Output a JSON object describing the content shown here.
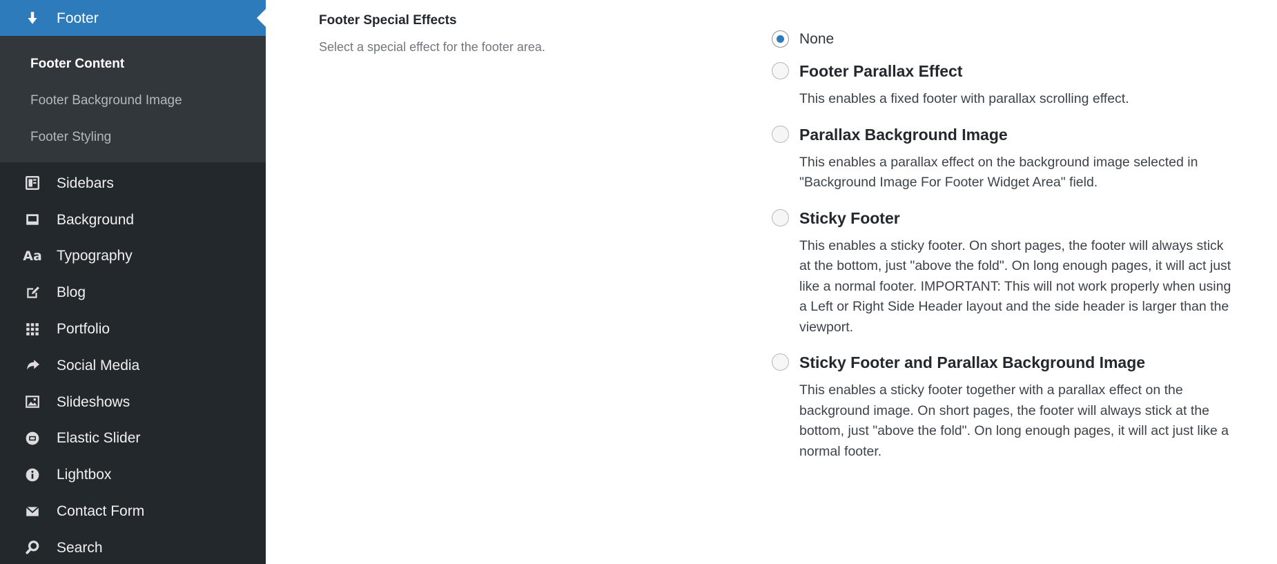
{
  "sidebar": {
    "active": {
      "label": "Footer",
      "icon": "arrow-down-icon"
    },
    "submenu": [
      {
        "label": "Footer Content",
        "current": true
      },
      {
        "label": "Footer Background Image",
        "current": false
      },
      {
        "label": "Footer Styling",
        "current": false
      }
    ],
    "items": [
      {
        "label": "Sidebars",
        "icon": "sidebars-icon"
      },
      {
        "label": "Background",
        "icon": "background-icon"
      },
      {
        "label": "Typography",
        "icon": "typography-icon"
      },
      {
        "label": "Blog",
        "icon": "blog-icon"
      },
      {
        "label": "Portfolio",
        "icon": "portfolio-icon"
      },
      {
        "label": "Social Media",
        "icon": "share-icon"
      },
      {
        "label": "Slideshows",
        "icon": "image-icon"
      },
      {
        "label": "Elastic Slider",
        "icon": "slider-icon"
      },
      {
        "label": "Lightbox",
        "icon": "info-icon"
      },
      {
        "label": "Contact Form",
        "icon": "mail-icon"
      },
      {
        "label": "Search",
        "icon": "search-icon"
      }
    ],
    "typography_icon_text": "Aa"
  },
  "field": {
    "title": "Footer Special Effects",
    "description": "Select a special effect for the footer area."
  },
  "options": [
    {
      "label": "None",
      "checked": true,
      "description": ""
    },
    {
      "label": "Footer Parallax Effect",
      "checked": false,
      "description": "This enables a fixed footer with parallax scrolling effect."
    },
    {
      "label": "Parallax Background Image",
      "checked": false,
      "description": "This enables a parallax effect on the background image selected in \"Background Image For Footer Widget Area\" field."
    },
    {
      "label": "Sticky Footer",
      "checked": false,
      "description": "This enables a sticky footer. On short pages, the footer will always stick at the bottom, just \"above the fold\". On long enough pages, it will act just like a normal footer. IMPORTANT: This will not work properly when using a Left or Right Side Header layout and the side header is larger than the viewport."
    },
    {
      "label": "Sticky Footer and Parallax Background Image",
      "checked": false,
      "description": "This enables a sticky footer together with a parallax effect on the background image. On short pages, the footer will always stick at the bottom, just \"above the fold\". On long enough pages, it will act just like a normal footer."
    }
  ],
  "colors": {
    "sidebar_bg": "#23282d",
    "submenu_bg": "#32373c",
    "active_bg": "#2d7bba",
    "radio_checked": "#2d7bba"
  }
}
